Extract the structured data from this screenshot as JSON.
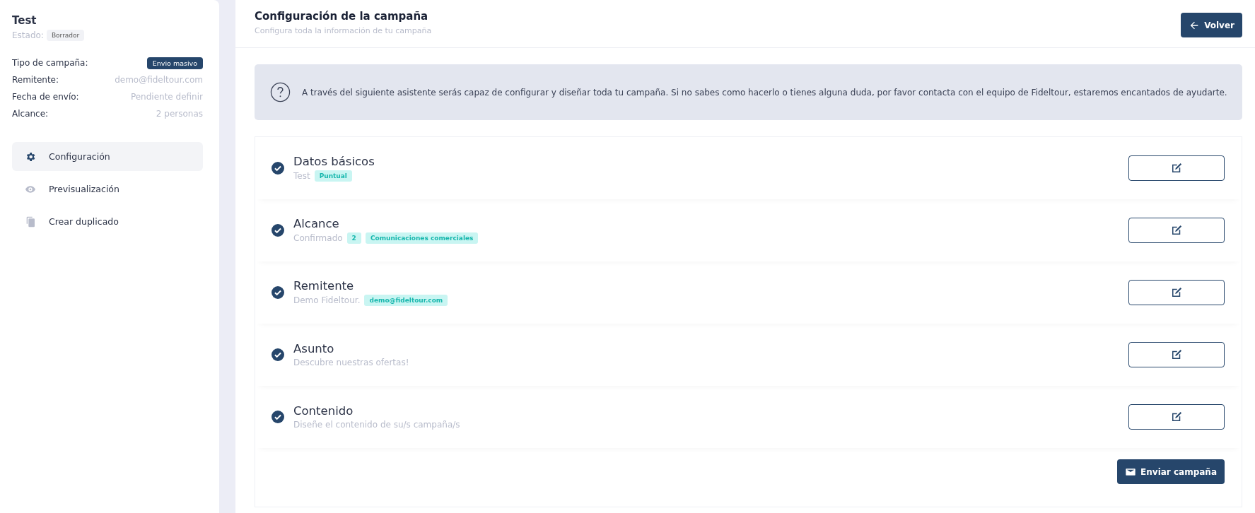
{
  "campaign": {
    "name": "Test",
    "status_label": "Estado:",
    "status": "Borrador"
  },
  "info": [
    {
      "label": "Tipo de campaña:",
      "value": "Envio masivo",
      "kind": "badge"
    },
    {
      "label": "Remitente:",
      "value": "demo@fideltour.com",
      "kind": "text"
    },
    {
      "label": "Fecha de envío:",
      "value": "Pendiente definir",
      "kind": "text"
    },
    {
      "label": "Alcance:",
      "value": "2 personas",
      "kind": "text"
    }
  ],
  "nav": [
    {
      "label": "Configuración",
      "kind": "gear",
      "selected": true
    },
    {
      "label": "Previsualización",
      "kind": "eye",
      "selected": false
    },
    {
      "label": "Crear duplicado",
      "kind": "copy",
      "selected": false
    }
  ],
  "header": {
    "title": "Configuración de la campaña",
    "subtitle": "Configura toda la información de tu campaña",
    "back_button": "Volver"
  },
  "notice": "A través del siguiente asistente serás capaz de configurar y diseñar toda tu campaña. Si no sabes como hacerlo o tienes alguna duda, por favor contacta con el equipo de Fideltour, estaremos encantados de ayudarte.",
  "steps": [
    {
      "title": "Datos básicos",
      "detail": "Test",
      "tags": [
        "Puntual"
      ],
      "done": true
    },
    {
      "title": "Alcance",
      "detail": "Confirmado",
      "tags": [
        "2",
        "Comunicaciones comerciales"
      ],
      "done": true
    },
    {
      "title": "Remitente",
      "detail": "Demo Fideltour.",
      "tags": [
        "demo@fideltour.com"
      ],
      "done": true
    },
    {
      "title": "Asunto",
      "detail": "Descubre nuestras ofertas!",
      "done": true
    },
    {
      "title": "Contenido",
      "detail": "Diseñe el contenido de su/s campaña/s",
      "done": true
    }
  ],
  "send_button": "Enviar campaña"
}
